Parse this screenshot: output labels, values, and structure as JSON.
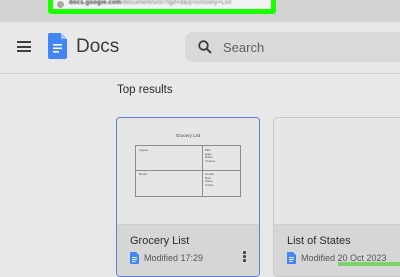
{
  "browser": {
    "url_bold": "docs.google.com",
    "url_rest": "/document/u/0/?tgif=d&q=Grocery+List"
  },
  "header": {
    "app_title": "Docs",
    "search_placeholder": "Search"
  },
  "main": {
    "section_heading": "Top results",
    "results": [
      {
        "name": "Grocery List",
        "meta": "Modified 17:29",
        "preview": {
          "title": "Grocery List",
          "cells": [
            [
              "Apples",
              "Milk\nEggs\nButter\nCheese"
            ],
            [
              "Bread",
              "Cereal\nRice\nPasta\nCoffee"
            ]
          ]
        }
      },
      {
        "name": "List of States",
        "meta": "Modified 20 Oct 2023"
      }
    ]
  },
  "colors": {
    "highlight": "#18ff00",
    "docs_blue": "#4285f4",
    "selected_border": "#5b7fd6"
  }
}
